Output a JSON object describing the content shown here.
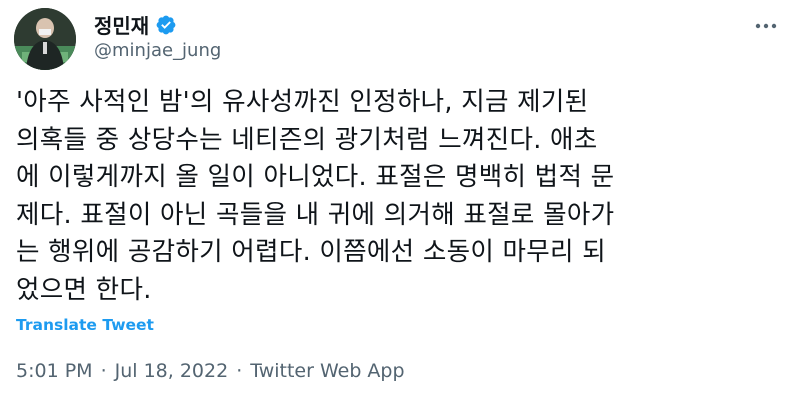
{
  "author": {
    "display_name": "정민재",
    "handle": "@minjae_jung"
  },
  "icons": {
    "verified": "verified-badge-icon",
    "more": "more-options-icon"
  },
  "tweet": {
    "text": "'아주 사적인 밤'의 유사성까진 인정하나, 지금 제기된\n의혹들 중 상당수는 네티즌의 광기처럼 느껴진다. 애초\n에 이렇게까지 올 일이 아니었다. 표절은 명백히 법적 문\n제다. 표절이 아닌 곡들을 내 귀에 의거해 표절로 몰아가\n는 행위에 공감하기 어렵다. 이쯤에선 소동이 마무리 되\n었으면 한다.",
    "translate_label": "Translate Tweet"
  },
  "meta": {
    "time": "5:01 PM",
    "sep1": "·",
    "date": "Jul 18, 2022",
    "sep2": "·",
    "source": "Twitter Web App"
  },
  "colors": {
    "link": "#1d9bf0",
    "secondary_text": "#536471",
    "primary_text": "#0f1419"
  }
}
